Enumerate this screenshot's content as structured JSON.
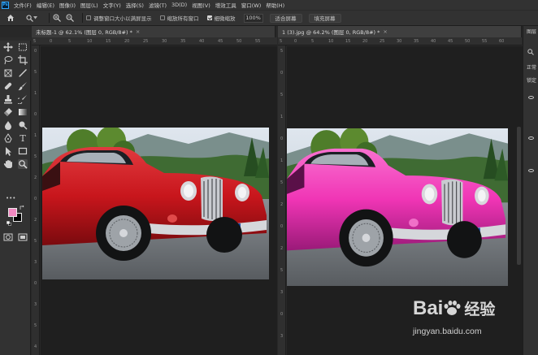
{
  "app": {
    "logo_text": "Ps",
    "accent": "#31a8ff"
  },
  "menu": [
    "文件(F)",
    "编辑(E)",
    "图像(I)",
    "图层(L)",
    "文字(Y)",
    "选择(S)",
    "滤镜(T)",
    "3D(D)",
    "视图(V)",
    "增效工具",
    "窗口(W)",
    "帮助(H)"
  ],
  "options": {
    "resize_window_label": "调整窗口大小以满屏显示",
    "resize_window_checked": false,
    "zoom_all_label": "缩放所有窗口",
    "zoom_all_checked": false,
    "scrubby_zoom_label": "细微缩放",
    "scrubby_zoom_checked": true,
    "zoom_value": "100%",
    "fit_screen_label": "适合屏幕",
    "fill_screen_label": "填充屏幕"
  },
  "tabs": [
    {
      "title": "未标题-1 @ 62.1% (图层 0, RGB/8#) *",
      "close": "×"
    },
    {
      "title": "1 (3).jpg @ 64.2% (图层 0, RGB/8#) *",
      "close": "×"
    }
  ],
  "ruler": {
    "left_ticks": [
      "5",
      "0",
      "5",
      "10",
      "15",
      "20",
      "25",
      "30",
      "35",
      "40",
      "45",
      "50",
      "55"
    ],
    "right_ticks": [
      "5",
      "0",
      "5",
      "10",
      "15",
      "20",
      "25",
      "30",
      "35",
      "40",
      "45",
      "50",
      "55",
      "60"
    ],
    "left_vticks": [
      "0",
      "5",
      "1",
      "0",
      "1",
      "5",
      "2",
      "0",
      "2",
      "5",
      "3",
      "0",
      "3",
      "5",
      "4"
    ],
    "right_vticks": [
      "5",
      "0",
      "5",
      "1",
      "0",
      "1",
      "5",
      "2",
      "0",
      "2",
      "5",
      "3",
      "0",
      "3"
    ]
  },
  "colors": {
    "foreground": "#f088c0",
    "background": "#000000",
    "car_left": "#c8161c",
    "car_right": "#f035b5"
  },
  "panel": {
    "tab_label": "图层",
    "search_icon": "search-icon",
    "normal_label": "正常",
    "lock_label": "锁定"
  },
  "watermark": {
    "brand": "Bai",
    "brand_suffix": "经验",
    "url": "jingyan.baidu.com"
  }
}
